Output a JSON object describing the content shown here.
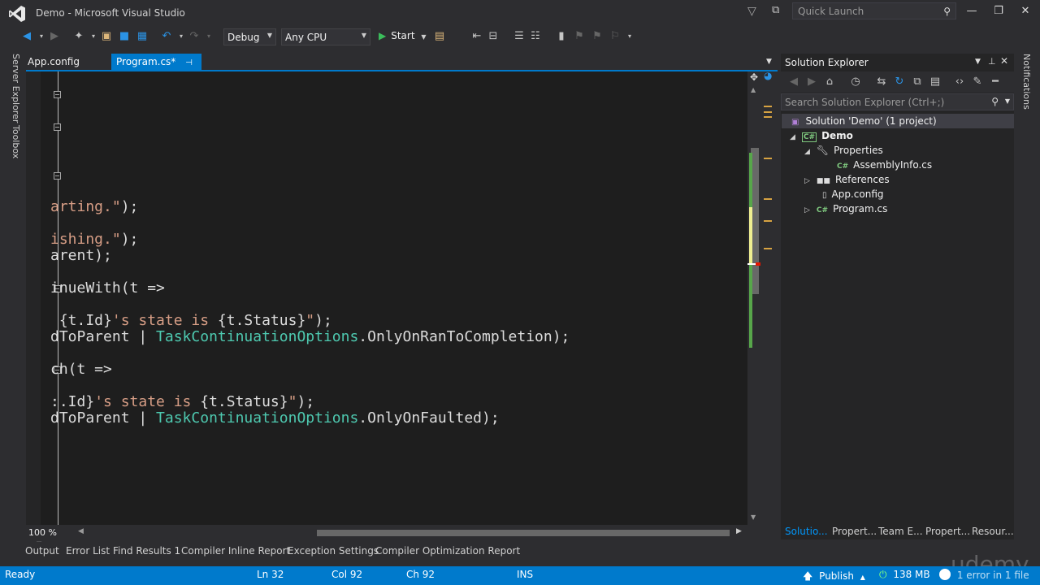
{
  "window": {
    "title": "Demo - Microsoft Visual Studio",
    "quick_launch_placeholder": "Quick Launch",
    "buttons": {
      "minimize": "—",
      "restore": "❐",
      "close": "✕"
    }
  },
  "toolbar": {
    "config": "Debug",
    "platform": "Any CPU",
    "start_label": "Start"
  },
  "left_tabs": [
    "Server Explorer",
    "Toolbox"
  ],
  "doc_tabs": [
    {
      "label": "App.config",
      "active": false
    },
    {
      "label": "Program.cs*",
      "active": true
    }
  ],
  "code_lines": [
    {
      "segments": [
        {
          "t": "arting.\"",
          "c": "str"
        },
        {
          "t": ");",
          "c": ""
        }
      ]
    },
    {
      "segments": [
        {
          "t": "ishing.\"",
          "c": "str"
        },
        {
          "t": ");",
          "c": ""
        }
      ]
    },
    {
      "segments": [
        {
          "t": "arent);",
          "c": ""
        }
      ]
    },
    {
      "segments": [
        {
          "t": "inueWith(t =>",
          "c": ""
        }
      ]
    },
    {
      "segments": [
        {
          "t": " {t.Id}",
          "c": ""
        },
        {
          "t": "'s state is ",
          "c": "str"
        },
        {
          "t": "{t.Status}",
          "c": ""
        },
        {
          "t": "\"",
          "c": "str"
        },
        {
          "t": ");",
          "c": ""
        }
      ]
    },
    {
      "segments": [
        {
          "t": "dToParent | ",
          "c": ""
        },
        {
          "t": "TaskContinuationOptions",
          "c": "typ"
        },
        {
          "t": ".OnlyOnRanToCompletion);",
          "c": ""
        }
      ]
    },
    {
      "segments": [
        {
          "t": "ch(t =>",
          "c": ""
        }
      ]
    },
    {
      "segments": [
        {
          "t": ":.Id}",
          "c": ""
        },
        {
          "t": "'s state is ",
          "c": "str"
        },
        {
          "t": "{t.Status}",
          "c": ""
        },
        {
          "t": "\"",
          "c": "str"
        },
        {
          "t": ");",
          "c": ""
        }
      ]
    },
    {
      "segments": [
        {
          "t": "dToParent | ",
          "c": ""
        },
        {
          "t": "TaskContinuationOptions",
          "c": "typ"
        },
        {
          "t": ".OnlyOnFaulted);",
          "c": ""
        }
      ]
    }
  ],
  "editor": {
    "zoom": "100 %"
  },
  "solution_explorer": {
    "title": "Solution Explorer",
    "search_placeholder": "Search Solution Explorer (Ctrl+;)",
    "tree": [
      {
        "label": "Solution 'Demo' (1 project)",
        "bold": false,
        "selected": true
      },
      {
        "label": "Demo",
        "bold": true
      },
      {
        "label": "Properties"
      },
      {
        "label": "AssemblyInfo.cs"
      },
      {
        "label": "References"
      },
      {
        "label": "App.config"
      },
      {
        "label": "Program.cs"
      }
    ],
    "bottom_tabs": [
      "Solutio...",
      "Propert...",
      "Team E...",
      "Propert...",
      "Resour..."
    ]
  },
  "notifications_label": "Notifications",
  "output_tabs": [
    "Output",
    "Error List",
    "Find Results 1",
    "Compiler Inline Report",
    "Exception Settings",
    "Compiler Optimization Report"
  ],
  "status": {
    "ready": "Ready",
    "ln": "Ln 32",
    "col": "Col 92",
    "ch": "Ch 92",
    "ins": "INS",
    "publish": "Publish",
    "memory": "138 MB",
    "errors": "1 error in 1 file"
  },
  "watermark": "udemy",
  "colors": {
    "accent": "#007acc",
    "string": "#d69d85",
    "type": "#4ec9b0"
  }
}
